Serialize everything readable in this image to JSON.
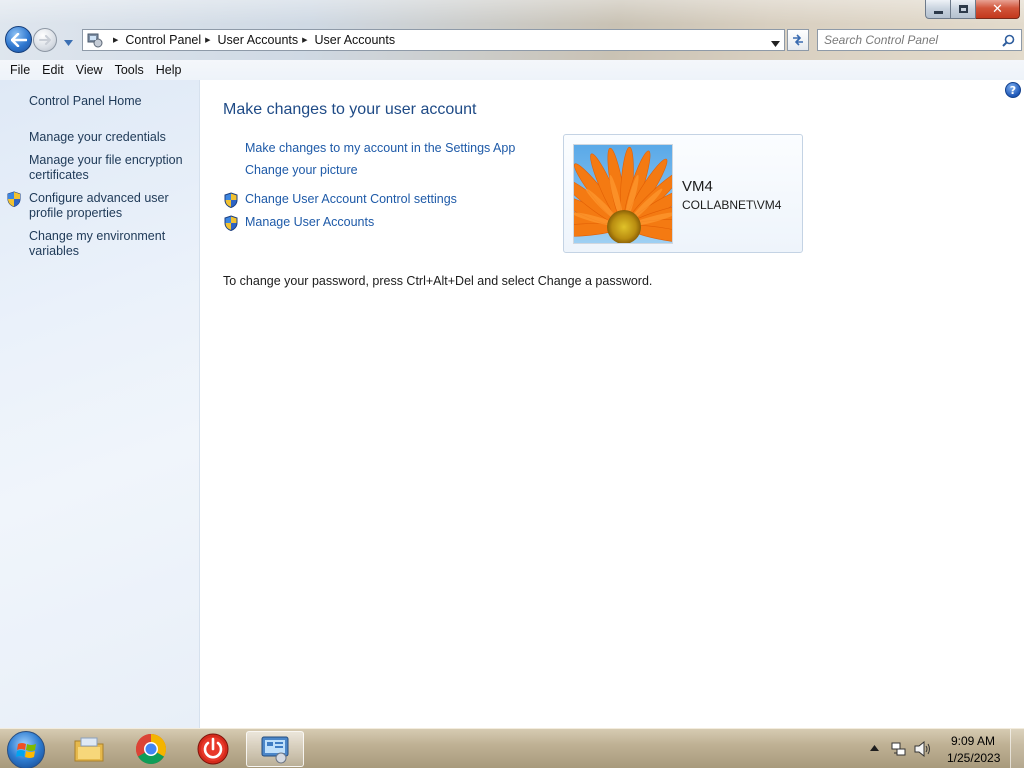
{
  "window": {
    "minimize_icon": "minimize-icon",
    "maximize_icon": "maximize-icon",
    "close_icon": "close-icon"
  },
  "nav": {
    "back_icon": "back-arrow-icon",
    "forward_icon": "forward-arrow-icon",
    "recent_icon": "chevron-down-icon"
  },
  "address_bar": {
    "root_icon": "control-panel-icon",
    "breadcrumbs": [
      "Control Panel",
      "User Accounts",
      "User Accounts"
    ]
  },
  "search": {
    "placeholder": "Search Control Panel"
  },
  "menu": [
    "File",
    "Edit",
    "View",
    "Tools",
    "Help"
  ],
  "sidebar": {
    "items": [
      {
        "label": "Control Panel Home",
        "shield": false
      },
      {
        "label": "Manage your credentials",
        "shield": false
      },
      {
        "label": "Manage your file encryption certificates",
        "shield": false
      },
      {
        "label": "Configure advanced user profile properties",
        "shield": true
      },
      {
        "label": "Change my environment variables",
        "shield": false
      }
    ]
  },
  "main": {
    "title": "Make changes to your user account",
    "tasks": [
      {
        "label": "Make changes to my account in the Settings App",
        "shield": false
      },
      {
        "label": "Change your picture",
        "shield": false
      },
      {
        "label": "Change User Account Control settings",
        "shield": true
      },
      {
        "label": "Manage User Accounts",
        "shield": true
      }
    ],
    "account": {
      "name": "VM4",
      "domain": "COLLABNET\\VM4",
      "picture": "orange-flower"
    },
    "password_note": "To change your password, press Ctrl+Alt+Del and select Change a password."
  },
  "taskbar": {
    "start_icon": "windows-start-icon",
    "pinned": [
      "file-explorer-icon",
      "chrome-icon",
      "power-app-icon",
      "control-panel-icon"
    ],
    "active": "control-panel-icon",
    "time": "9:09 AM",
    "date": "1/25/2023"
  },
  "colors": {
    "link": "#1e5aa8",
    "title": "#1e4a86",
    "sidebar_bg": "#e8eff8"
  }
}
